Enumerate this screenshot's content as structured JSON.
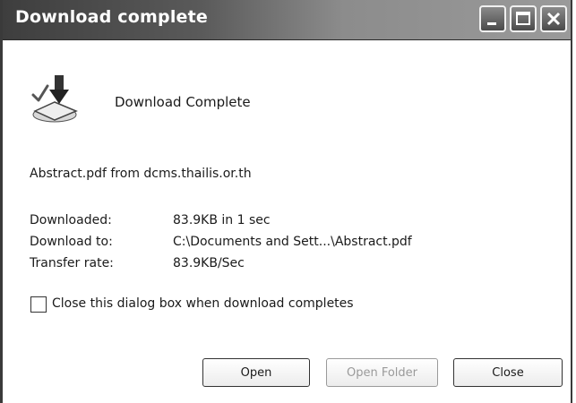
{
  "window": {
    "title": "Download complete",
    "controls": [
      "minimize-icon",
      "maximize-icon",
      "close-icon"
    ]
  },
  "header": {
    "icon": "download-complete-icon",
    "heading": "Download Complete"
  },
  "file_source": "Abstract.pdf from dcms.thailis.or.th",
  "details": [
    {
      "label": "Downloaded:",
      "value": "83.9KB in 1 sec"
    },
    {
      "label": "Download to:",
      "value": "C:\\Documents and Sett...\\Abstract.pdf"
    },
    {
      "label": "Transfer rate:",
      "value": "83.9KB/Sec"
    }
  ],
  "close_on_complete": {
    "label": "Close this dialog box when download completes",
    "checked": false
  },
  "buttons": {
    "open": "Open",
    "open_folder": "Open Folder",
    "close": "Close"
  },
  "colors": {
    "title_bar": "#5a5a5a",
    "title_text": "#ffffff",
    "disabled_text": "#9a9a9a"
  }
}
